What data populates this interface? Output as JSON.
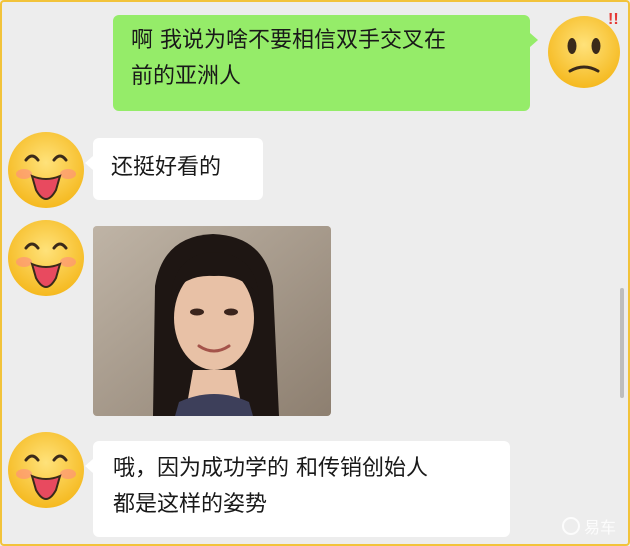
{
  "messages": [
    {
      "side": "out",
      "text": "啊 我说为啥不要相信双手交叉在前的亚洲人"
    },
    {
      "side": "in",
      "text": "还挺好看的"
    },
    {
      "side": "in",
      "type": "image",
      "description_icon": "photo-of-woman"
    },
    {
      "side": "in",
      "text": "哦，因为成功学的 和传销创始人都是这样的姿势"
    }
  ],
  "msg1": {
    "line1": "啊 我说为啥不要相信双手交叉在",
    "line2": "前的亚洲人"
  },
  "msg2": {
    "text": "还挺好看的"
  },
  "msg4": {
    "line1": "哦，因为成功学的 和传销创始人",
    "line2": "都是这样的姿势"
  },
  "avatars": {
    "self": "worried-face-emoji-icon",
    "other": "tongue-out-face-emoji-icon"
  },
  "watermark": {
    "text": "易车"
  },
  "colors": {
    "background": "#ededed",
    "outgoing_bubble": "#95ec69",
    "incoming_bubble": "#ffffff",
    "emoji_face": "#f9c23c",
    "frame": "#f2c33a"
  }
}
